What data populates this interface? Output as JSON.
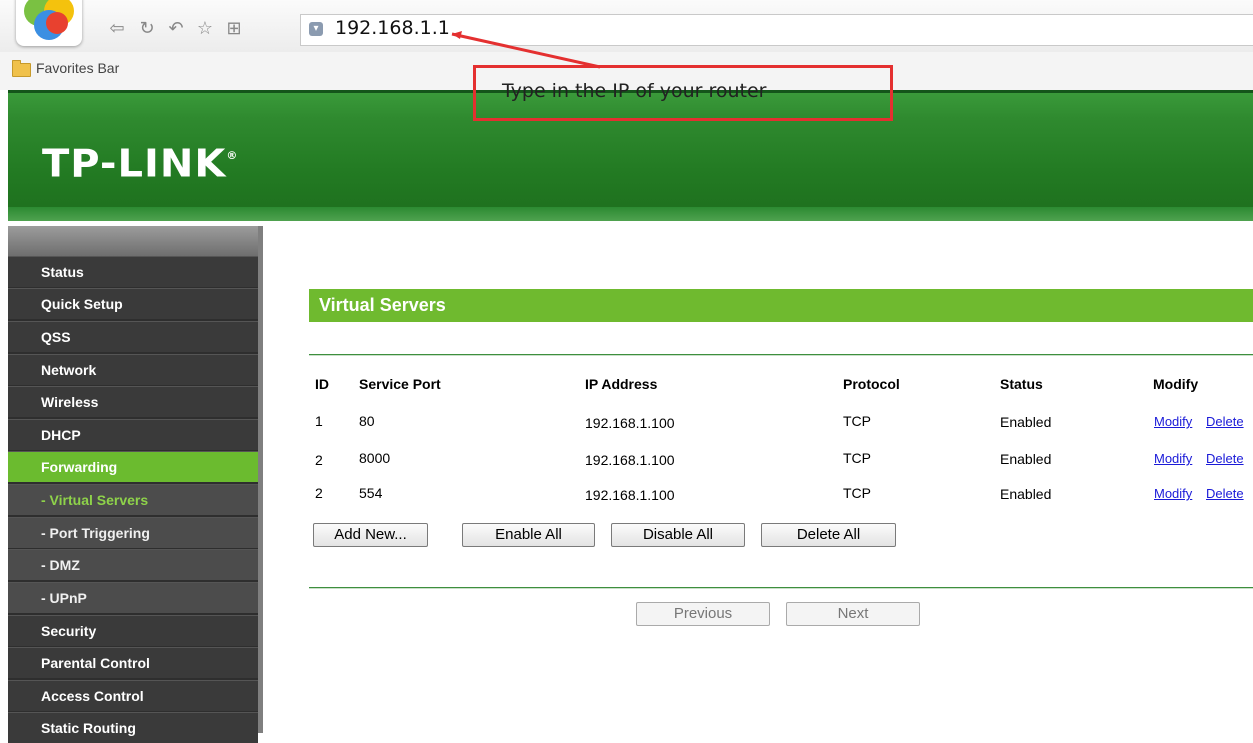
{
  "browser": {
    "address": "192.168.1.1",
    "favorites_label": "Favorites Bar",
    "nav_icons": [
      "back-icon",
      "refresh-icon",
      "undo-icon",
      "star-icon",
      "grid-icon"
    ]
  },
  "annotation": {
    "text": "Type in the IP of your router",
    "color": "#e43030"
  },
  "router": {
    "brand": "TP-LINK",
    "brand_reg": "®",
    "accent_green": "#6fba2f"
  },
  "sidebar": {
    "items": [
      {
        "label": "Status"
      },
      {
        "label": "Quick Setup"
      },
      {
        "label": "QSS"
      },
      {
        "label": "Network"
      },
      {
        "label": "Wireless"
      },
      {
        "label": "DHCP"
      },
      {
        "label": "Forwarding"
      },
      {
        "label": "- Virtual Servers"
      },
      {
        "label": "- Port Triggering"
      },
      {
        "label": "- DMZ"
      },
      {
        "label": "- UPnP"
      },
      {
        "label": "Security"
      },
      {
        "label": "Parental Control"
      },
      {
        "label": "Access Control"
      },
      {
        "label": "Static Routing"
      }
    ]
  },
  "main": {
    "title": "Virtual Servers",
    "table": {
      "headers": [
        "ID",
        "Service Port",
        "IP Address",
        "Protocol",
        "Status",
        "Modify"
      ],
      "rows": [
        {
          "id": "1",
          "port": "80",
          "ip": "192.168.1.100",
          "protocol": "TCP",
          "status": "Enabled",
          "modify": "Modify",
          "delete": "Delete"
        },
        {
          "id": "2",
          "port": "8000",
          "ip": "192.168.1.100",
          "protocol": "TCP",
          "status": "Enabled",
          "modify": "Modify",
          "delete": "Delete"
        },
        {
          "id": "2",
          "port": "554",
          "ip": "192.168.1.100",
          "protocol": "TCP",
          "status": "Enabled",
          "modify": "Modify",
          "delete": "Delete"
        }
      ]
    },
    "buttons": {
      "add_new": "Add New...",
      "enable_all": "Enable All",
      "disable_all": "Disable All",
      "delete_all": "Delete All",
      "previous": "Previous",
      "next": "Next"
    }
  }
}
